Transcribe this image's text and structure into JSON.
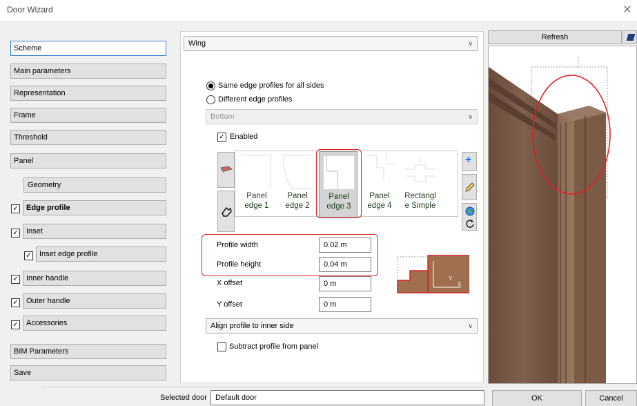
{
  "window": {
    "title": "Door Wizard",
    "close_glyph": "✕"
  },
  "nav": {
    "items": [
      {
        "label": "Scheme",
        "checkbox": false
      },
      {
        "label": "Main parameters",
        "checkbox": false
      },
      {
        "label": "Representation",
        "checkbox": false
      },
      {
        "label": "Frame",
        "checkbox": false
      },
      {
        "label": "Threshold",
        "checkbox": false
      },
      {
        "label": "Panel",
        "checkbox": false
      },
      {
        "label": "Geometry",
        "checkbox": false
      },
      {
        "label": "Edge profile",
        "checkbox": true
      },
      {
        "label": "Inset",
        "checkbox": true
      },
      {
        "label": "Inset edge profile",
        "checkbox": true
      },
      {
        "label": "Inner handle",
        "checkbox": true
      },
      {
        "label": "Outer handle",
        "checkbox": true
      },
      {
        "label": "Accessories",
        "checkbox": true
      },
      {
        "label": "BIM Parameters",
        "checkbox": false
      },
      {
        "label": "Save",
        "checkbox": false
      }
    ]
  },
  "main": {
    "section_combo": "Wing",
    "radio_same": "Same edge profiles for all sides",
    "radio_different": "Different edge profiles",
    "side_combo": "Bottom",
    "enabled_label": "Enabled",
    "gallery": [
      {
        "line1": "Panel",
        "line2": "edge 1"
      },
      {
        "line1": "Panel",
        "line2": "edge 2"
      },
      {
        "line1": "Panel",
        "line2": "edge 3"
      },
      {
        "line1": "Panel",
        "line2": "edge 4"
      },
      {
        "line1": "Rectangl",
        "line2": "e Simple"
      }
    ],
    "selected_profile": "Panel edge 3",
    "fields": [
      {
        "label": "Profile width",
        "value": "0.02 m"
      },
      {
        "label": "Profile height",
        "value": "0.04 m"
      },
      {
        "label": "X offset",
        "value": "0 m"
      },
      {
        "label": "Y offset",
        "value": "0 m"
      }
    ],
    "align_combo": "Align profile to inner side",
    "subtract_label": "Subtract profile from panel",
    "diagram_axes": {
      "y": "Y",
      "x": "X"
    }
  },
  "preview": {
    "refresh_label": "Refresh"
  },
  "footer": {
    "selected_door_label": "Selected door",
    "selected_door_value": "Default door",
    "ok_label": "OK",
    "cancel_label": "Cancel"
  },
  "colors": {
    "accent": "#2f7fd6",
    "highlight": "#e02020",
    "wood": "#7a5a45"
  }
}
